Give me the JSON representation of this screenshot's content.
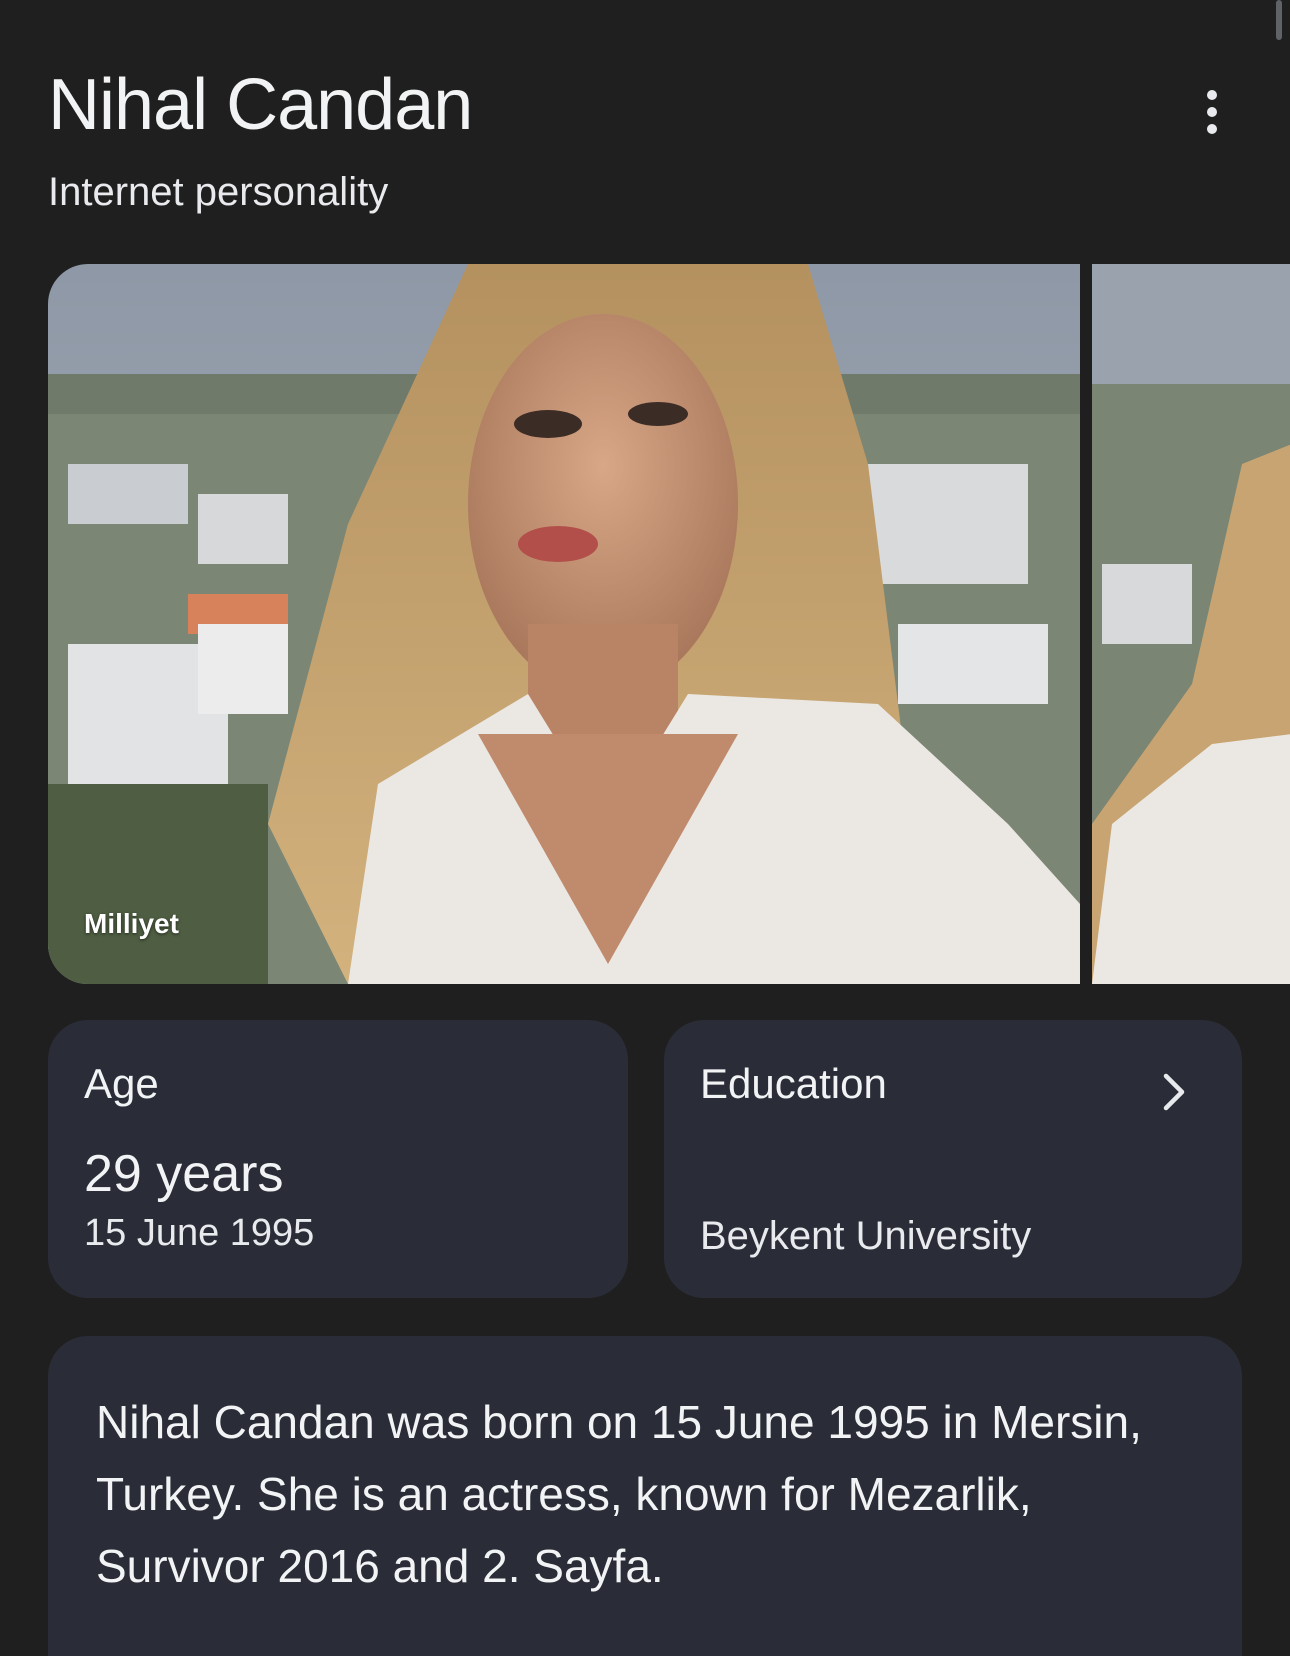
{
  "header": {
    "title": "Nihal Candan",
    "subtitle": "Internet personality",
    "more_icon": "more-vert-icon"
  },
  "gallery": {
    "source_label": "Milliyet"
  },
  "facts": {
    "age": {
      "label": "Age",
      "value": "29 years",
      "date": "15 June 1995"
    },
    "education": {
      "label": "Education",
      "value": "Beykent University",
      "icon": "chevron-right-icon"
    }
  },
  "description": {
    "text": "Nihal Candan was born on 15 June 1995 in Mersin, Turkey. She is an actress, known for Mezarlik, Survivor 2016 and 2. Sayfa."
  },
  "colors": {
    "background": "#1f1f1f",
    "card": "#2a2d37",
    "text": "#e8eaed"
  }
}
